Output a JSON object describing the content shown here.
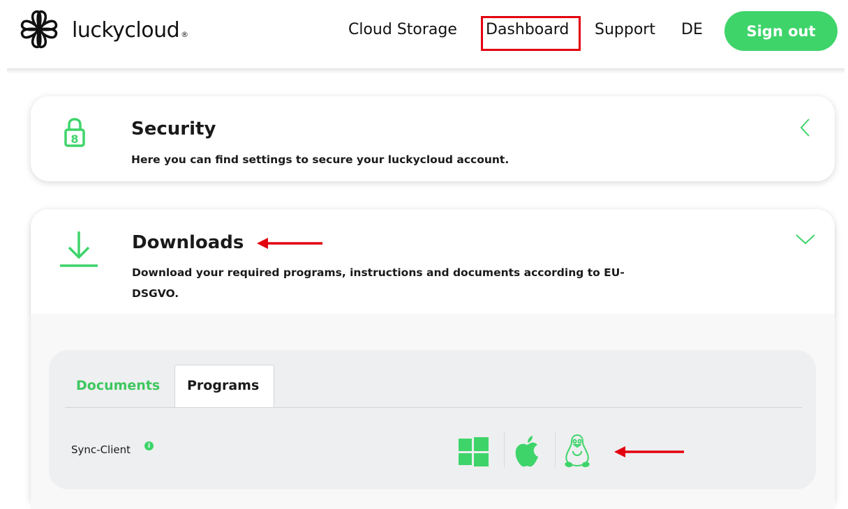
{
  "header": {
    "brand": "luckycloud",
    "brand_mark": "®",
    "nav": {
      "cloud_storage": "Cloud Storage",
      "dashboard": "Dashboard",
      "support": "Support",
      "language": "DE"
    },
    "sign_out": "Sign out"
  },
  "security": {
    "title": "Security",
    "description": "Here you can find settings to secure your luckycloud account.",
    "icon": "lock-icon"
  },
  "downloads": {
    "title": "Downloads",
    "description_line1": "Download your required programs, instructions and documents according to EU-",
    "description_line2": "DSGVO.",
    "icon": "download-icon",
    "tabs": {
      "documents": "Documents",
      "programs": "Programs"
    },
    "rows": [
      {
        "label": "Sync-Client",
        "info": "i",
        "platforms": [
          "windows-icon",
          "apple-icon",
          "linux-icon"
        ]
      }
    ]
  },
  "colors": {
    "accent_green": "#3ed46a",
    "annotation_red": "#e3000f"
  }
}
